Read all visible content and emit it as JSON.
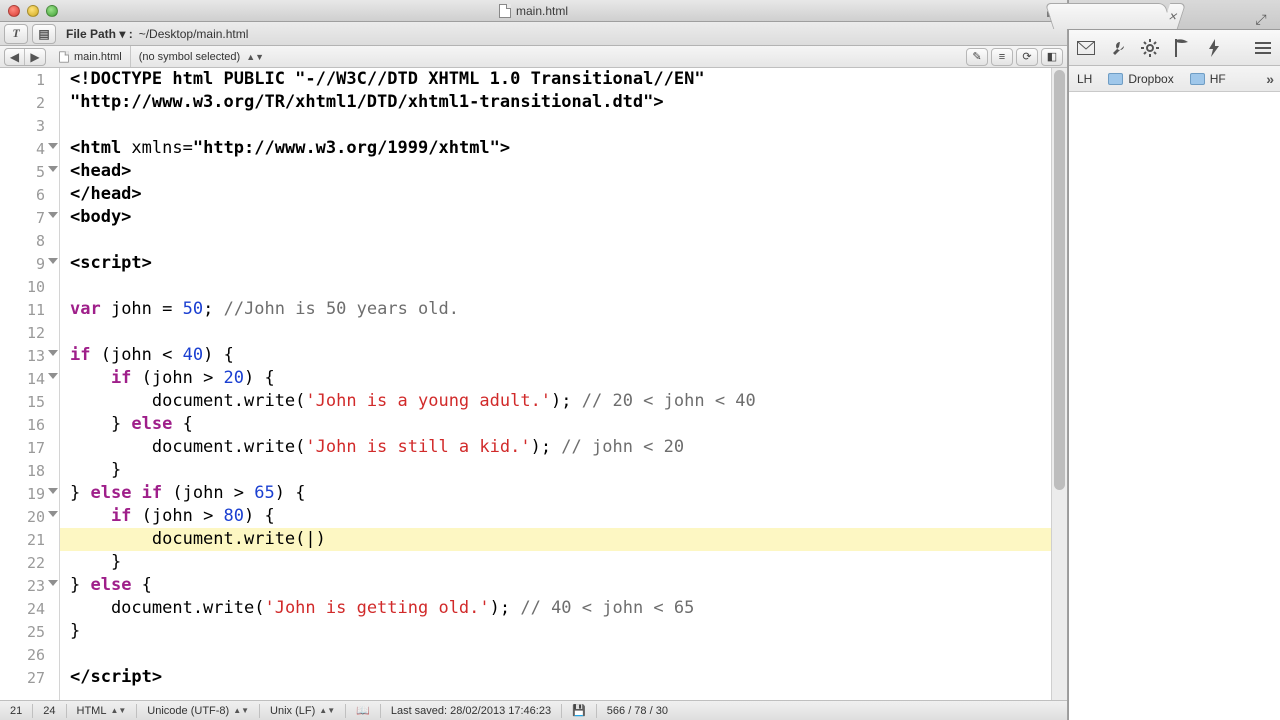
{
  "window": {
    "title": "main.html"
  },
  "pathbar": {
    "label": "File Path ▾ :",
    "value": "~/Desktop/main.html"
  },
  "symbolbar": {
    "file": "main.html",
    "symbol": "(no symbol selected)"
  },
  "code": {
    "lines": [
      {
        "n": 1,
        "fold": false,
        "tokens": [
          {
            "t": "<!DOCTYPE html PUBLIC ",
            "c": "c-punct"
          },
          {
            "t": "\"-//W3C//DTD XHTML 1.0 Transitional//EN\"",
            "c": "c-name"
          }
        ]
      },
      {
        "n": 2,
        "fold": false,
        "tokens": [
          {
            "t": "\"http://www.w3.org/TR/xhtml1/DTD/xhtml1-transitional.dtd\"",
            "c": "c-name"
          },
          {
            "t": ">",
            "c": "c-punct"
          }
        ]
      },
      {
        "n": 3,
        "fold": false,
        "tokens": []
      },
      {
        "n": 4,
        "fold": true,
        "tokens": [
          {
            "t": "<html ",
            "c": "c-punct"
          },
          {
            "t": "xmlns",
            "c": "c-op"
          },
          {
            "t": "=",
            "c": "c-op"
          },
          {
            "t": "\"http://www.w3.org/1999/xhtml\"",
            "c": "c-name"
          },
          {
            "t": ">",
            "c": "c-punct"
          }
        ]
      },
      {
        "n": 5,
        "fold": true,
        "tokens": [
          {
            "t": "<head>",
            "c": "c-punct"
          }
        ]
      },
      {
        "n": 6,
        "fold": false,
        "tokens": [
          {
            "t": "</head>",
            "c": "c-punct"
          }
        ]
      },
      {
        "n": 7,
        "fold": true,
        "tokens": [
          {
            "t": "<body>",
            "c": "c-punct"
          }
        ]
      },
      {
        "n": 8,
        "fold": false,
        "tokens": []
      },
      {
        "n": 9,
        "fold": true,
        "tokens": [
          {
            "t": "<script>",
            "c": "c-punct"
          }
        ]
      },
      {
        "n": 10,
        "fold": false,
        "tokens": []
      },
      {
        "n": 11,
        "fold": false,
        "tokens": [
          {
            "t": "var ",
            "c": "c-key"
          },
          {
            "t": "john ",
            "c": "c-op"
          },
          {
            "t": "= ",
            "c": "c-op"
          },
          {
            "t": "50",
            "c": "c-num"
          },
          {
            "t": "; ",
            "c": "c-op"
          },
          {
            "t": "//John is 50 years old.",
            "c": "c-cmt"
          }
        ]
      },
      {
        "n": 12,
        "fold": false,
        "tokens": []
      },
      {
        "n": 13,
        "fold": true,
        "tokens": [
          {
            "t": "if ",
            "c": "c-key"
          },
          {
            "t": "(john < ",
            "c": "c-op"
          },
          {
            "t": "40",
            "c": "c-num"
          },
          {
            "t": ") {",
            "c": "c-op"
          }
        ]
      },
      {
        "n": 14,
        "fold": true,
        "tokens": [
          {
            "t": "    if ",
            "c": "c-key"
          },
          {
            "t": "(john > ",
            "c": "c-op"
          },
          {
            "t": "20",
            "c": "c-num"
          },
          {
            "t": ") {",
            "c": "c-op"
          }
        ]
      },
      {
        "n": 15,
        "fold": false,
        "tokens": [
          {
            "t": "        document.write(",
            "c": "c-op"
          },
          {
            "t": "'John is a young adult.'",
            "c": "c-str"
          },
          {
            "t": "); ",
            "c": "c-op"
          },
          {
            "t": "// 20 < john < 40",
            "c": "c-cmt"
          }
        ]
      },
      {
        "n": 16,
        "fold": false,
        "tokens": [
          {
            "t": "    } ",
            "c": "c-op"
          },
          {
            "t": "else ",
            "c": "c-key"
          },
          {
            "t": "{",
            "c": "c-op"
          }
        ]
      },
      {
        "n": 17,
        "fold": false,
        "tokens": [
          {
            "t": "        document.write(",
            "c": "c-op"
          },
          {
            "t": "'John is still a kid.'",
            "c": "c-str"
          },
          {
            "t": "); ",
            "c": "c-op"
          },
          {
            "t": "// john < 20",
            "c": "c-cmt"
          }
        ]
      },
      {
        "n": 18,
        "fold": false,
        "tokens": [
          {
            "t": "    }",
            "c": "c-op"
          }
        ]
      },
      {
        "n": 19,
        "fold": true,
        "tokens": [
          {
            "t": "} ",
            "c": "c-op"
          },
          {
            "t": "else if ",
            "c": "c-key"
          },
          {
            "t": "(john > ",
            "c": "c-op"
          },
          {
            "t": "65",
            "c": "c-num"
          },
          {
            "t": ") {",
            "c": "c-op"
          }
        ]
      },
      {
        "n": 20,
        "fold": true,
        "tokens": [
          {
            "t": "    if ",
            "c": "c-key"
          },
          {
            "t": "(john > ",
            "c": "c-op"
          },
          {
            "t": "80",
            "c": "c-num"
          },
          {
            "t": ") {",
            "c": "c-op"
          }
        ]
      },
      {
        "n": 21,
        "fold": false,
        "hl": true,
        "tokens": [
          {
            "t": "        document.write(|)",
            "c": "c-op"
          }
        ]
      },
      {
        "n": 22,
        "fold": false,
        "tokens": [
          {
            "t": "    }",
            "c": "c-op"
          }
        ]
      },
      {
        "n": 23,
        "fold": true,
        "tokens": [
          {
            "t": "} ",
            "c": "c-op"
          },
          {
            "t": "else ",
            "c": "c-key"
          },
          {
            "t": "{",
            "c": "c-op"
          }
        ]
      },
      {
        "n": 24,
        "fold": false,
        "tokens": [
          {
            "t": "    document.write(",
            "c": "c-op"
          },
          {
            "t": "'John is getting old.'",
            "c": "c-str"
          },
          {
            "t": "); ",
            "c": "c-op"
          },
          {
            "t": "// 40 < john < 65",
            "c": "c-cmt"
          }
        ]
      },
      {
        "n": 25,
        "fold": false,
        "tokens": [
          {
            "t": "}",
            "c": "c-op"
          }
        ]
      },
      {
        "n": 26,
        "fold": false,
        "tokens": []
      },
      {
        "n": 27,
        "fold": false,
        "tokens": [
          {
            "t": "</script>",
            "c": "c-punct"
          }
        ]
      }
    ]
  },
  "status": {
    "line": "21",
    "col": "24",
    "language": "HTML",
    "encoding": "Unicode (UTF-8)",
    "lineending": "Unix (LF)",
    "saved": "Last saved: 28/02/2013 17:46:23",
    "bytes": "566 / 78 / 30"
  },
  "browser": {
    "bookmarks": [
      {
        "label": "LH"
      },
      {
        "label": "Dropbox"
      },
      {
        "label": "HF"
      }
    ]
  }
}
